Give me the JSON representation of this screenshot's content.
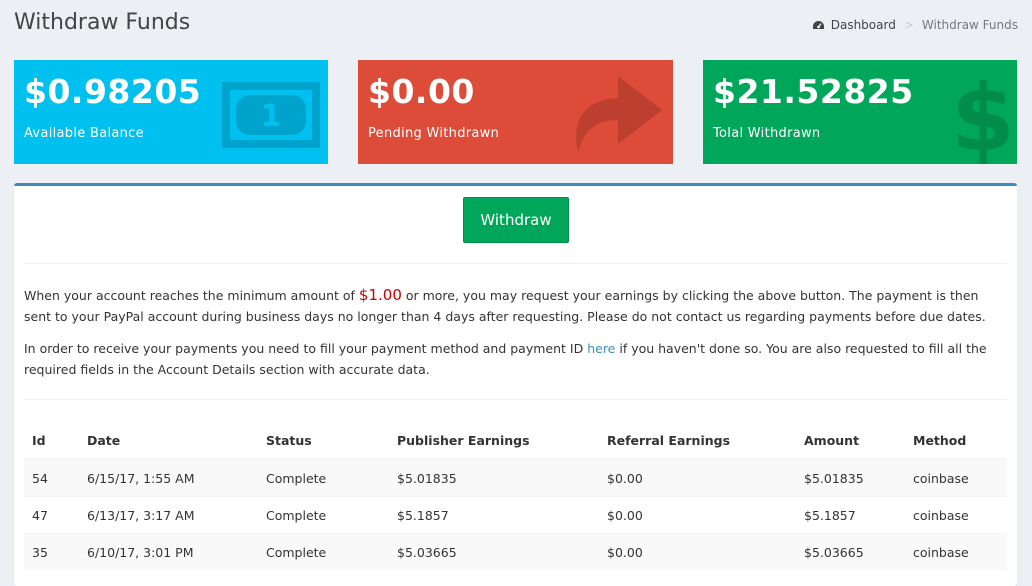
{
  "header": {
    "title": "Withdraw Funds",
    "breadcrumb": {
      "home": "Dashboard",
      "current": "Withdraw Funds",
      "separator": ">"
    }
  },
  "stats": {
    "available": {
      "value": "$0.98205",
      "label": "Available Balance",
      "color": "#00c0ef",
      "icon": "money-icon"
    },
    "pending": {
      "value": "$0.00",
      "label": "Pending Withdrawn",
      "color": "#dd4b39",
      "icon": "share-arrow-icon"
    },
    "total": {
      "value": "$21.52825",
      "label": "Tolal Withdrawn",
      "color": "#00a65a",
      "icon": "dollar-icon"
    }
  },
  "withdraw_button": "Withdraw",
  "info": {
    "p1_before": "When your account reaches the minimum amount of ",
    "min_amount": "$1.00",
    "p1_after": " or more, you may request your earnings by clicking the above button. The payment is then sent to your PayPal account during business days no longer than 4 days after requesting. Please do not contact us regarding payments before due dates.",
    "p2_before": "In order to receive your payments you need to fill your payment method and payment ID ",
    "p2_link": "here",
    "p2_after": " if you haven't done so. You are also requested to fill all the required fields in the Account Details section with accurate data."
  },
  "table": {
    "headers": [
      "Id",
      "Date",
      "Status",
      "Publisher Earnings",
      "Referral Earnings",
      "Amount",
      "Method"
    ],
    "rows": [
      [
        "54",
        "6/15/17, 1:55 AM",
        "Complete",
        "$5.01835",
        "$0.00",
        "$5.01835",
        "coinbase"
      ],
      [
        "47",
        "6/13/17, 3:17 AM",
        "Complete",
        "$5.1857",
        "$0.00",
        "$5.1857",
        "coinbase"
      ],
      [
        "35",
        "6/10/17, 3:01 PM",
        "Complete",
        "$5.03665",
        "$0.00",
        "$5.03665",
        "coinbase"
      ]
    ]
  }
}
